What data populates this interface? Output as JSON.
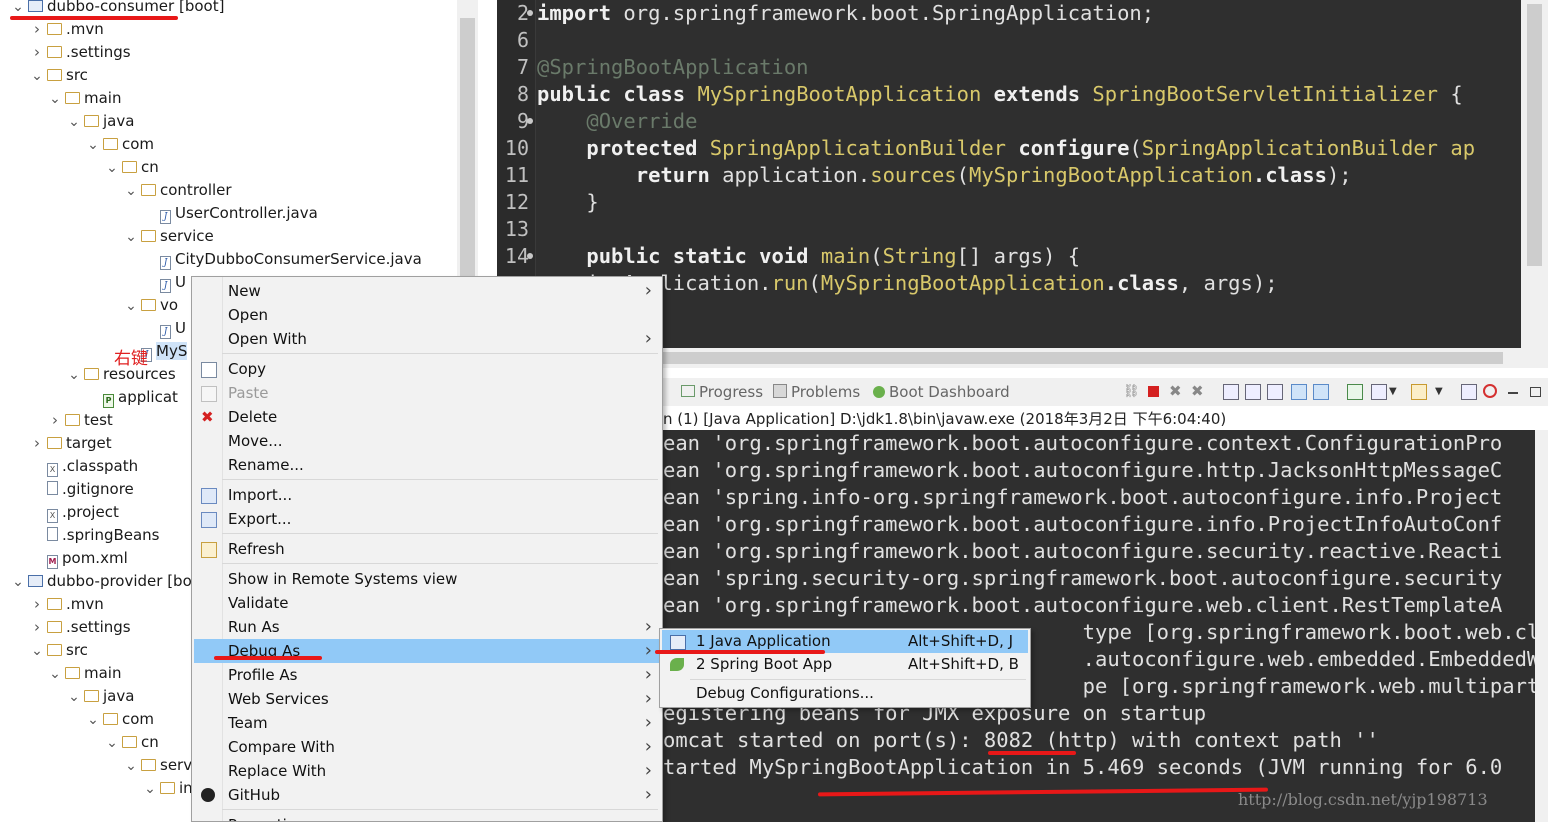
{
  "explorer": {
    "items": [
      {
        "label": "dubbo-consumer [boot]",
        "depth": 0,
        "expanded": true,
        "icon": "project"
      },
      {
        "label": ".mvn",
        "depth": 1,
        "expanded": false,
        "icon": "folder"
      },
      {
        "label": ".settings",
        "depth": 1,
        "expanded": false,
        "icon": "folder"
      },
      {
        "label": "src",
        "depth": 1,
        "expanded": true,
        "icon": "folder"
      },
      {
        "label": "main",
        "depth": 2,
        "expanded": true,
        "icon": "folder"
      },
      {
        "label": "java",
        "depth": 3,
        "expanded": true,
        "icon": "folder"
      },
      {
        "label": "com",
        "depth": 4,
        "expanded": true,
        "icon": "folder"
      },
      {
        "label": "cn",
        "depth": 5,
        "expanded": true,
        "icon": "folder"
      },
      {
        "label": "controller",
        "depth": 6,
        "expanded": true,
        "icon": "folder"
      },
      {
        "label": "UserController.java",
        "depth": 7,
        "icon": "java"
      },
      {
        "label": "service",
        "depth": 6,
        "expanded": true,
        "icon": "folder"
      },
      {
        "label": "CityDubboConsumerService.java",
        "depth": 7,
        "icon": "java"
      },
      {
        "label": "U",
        "depth": 7,
        "icon": "java"
      },
      {
        "label": "vo",
        "depth": 6,
        "expanded": true,
        "icon": "folder"
      },
      {
        "label": "U",
        "depth": 7,
        "icon": "java"
      },
      {
        "label": "MyS",
        "depth": 6,
        "icon": "java",
        "selected": true
      },
      {
        "label": "resources",
        "depth": 3,
        "expanded": true,
        "icon": "folder"
      },
      {
        "label": "applicat",
        "depth": 4,
        "icon": "properties"
      },
      {
        "label": "test",
        "depth": 2,
        "expanded": false,
        "icon": "folder"
      },
      {
        "label": "target",
        "depth": 1,
        "expanded": false,
        "icon": "folder"
      },
      {
        "label": ".classpath",
        "depth": 1,
        "icon": "xml"
      },
      {
        "label": ".gitignore",
        "depth": 1,
        "icon": "file"
      },
      {
        "label": ".project",
        "depth": 1,
        "icon": "xml"
      },
      {
        "label": ".springBeans",
        "depth": 1,
        "icon": "file"
      },
      {
        "label": "pom.xml",
        "depth": 1,
        "icon": "maven"
      },
      {
        "label": "dubbo-provider [bo",
        "depth": 0,
        "expanded": true,
        "icon": "project"
      },
      {
        "label": ".mvn",
        "depth": 1,
        "expanded": false,
        "icon": "folder"
      },
      {
        "label": ".settings",
        "depth": 1,
        "expanded": false,
        "icon": "folder"
      },
      {
        "label": "src",
        "depth": 1,
        "expanded": true,
        "icon": "folder"
      },
      {
        "label": "main",
        "depth": 2,
        "expanded": true,
        "icon": "folder"
      },
      {
        "label": "java",
        "depth": 3,
        "expanded": true,
        "icon": "folder"
      },
      {
        "label": "com",
        "depth": 4,
        "expanded": true,
        "icon": "folder"
      },
      {
        "label": "cn",
        "depth": 5,
        "expanded": true,
        "icon": "folder"
      },
      {
        "label": "serv",
        "depth": 6,
        "expanded": true,
        "icon": "folder"
      },
      {
        "label": "in",
        "depth": 7,
        "expanded": true,
        "icon": "folder"
      }
    ],
    "annotation": "右键"
  },
  "editor": {
    "lines": [
      {
        "num": "2",
        "marker": "fold",
        "parts": [
          {
            "t": "import ",
            "c": "kw"
          },
          {
            "t": "org.springframework.boot.SpringApplication;",
            "c": "pl"
          }
        ]
      },
      {
        "num": "6",
        "parts": []
      },
      {
        "num": "7",
        "parts": [
          {
            "t": "@SpringBootApplication",
            "c": "an"
          }
        ]
      },
      {
        "num": "8",
        "parts": [
          {
            "t": "public class ",
            "c": "kw"
          },
          {
            "t": "MySpringBootApplication ",
            "c": "ty"
          },
          {
            "t": "extends ",
            "c": "kw"
          },
          {
            "t": "SpringBootServletInitializer ",
            "c": "ty"
          },
          {
            "t": "{",
            "c": "pl"
          }
        ]
      },
      {
        "num": "9",
        "marker": "fold",
        "parts": [
          {
            "t": "    @Override",
            "c": "an"
          }
        ]
      },
      {
        "num": "10",
        "marker": "override",
        "parts": [
          {
            "t": "    protected ",
            "c": "kw"
          },
          {
            "t": "SpringApplicationBuilder ",
            "c": "ty"
          },
          {
            "t": "configure",
            "c": "cl"
          },
          {
            "t": "(",
            "c": "pl"
          },
          {
            "t": "SpringApplicationBuilder ap",
            "c": "ty"
          }
        ]
      },
      {
        "num": "11",
        "parts": [
          {
            "t": "        return ",
            "c": "kw"
          },
          {
            "t": "application.",
            "c": "pl"
          },
          {
            "t": "sources",
            "c": "ty"
          },
          {
            "t": "(",
            "c": "pl"
          },
          {
            "t": "MySpringBootApplication",
            "c": "ty"
          },
          {
            "t": ".class",
            "c": "kw"
          },
          {
            "t": ");",
            "c": "pl"
          }
        ]
      },
      {
        "num": "12",
        "parts": [
          {
            "t": "    }",
            "c": "pl"
          }
        ]
      },
      {
        "num": "13",
        "parts": []
      },
      {
        "num": "14",
        "marker": "fold",
        "parts": [
          {
            "t": "    public static void ",
            "c": "kw"
          },
          {
            "t": "main",
            "c": "ty"
          },
          {
            "t": "(",
            "c": "pl"
          },
          {
            "t": "String",
            "c": "ty"
          },
          {
            "t": "[] args) {",
            "c": "pl"
          }
        ]
      },
      {
        "num": "",
        "parts": [
          {
            "t": "  pringApplication.",
            "c": "pl"
          },
          {
            "t": "run",
            "c": "ty"
          },
          {
            "t": "(",
            "c": "pl"
          },
          {
            "t": "MySpringBootApplication",
            "c": "ty"
          },
          {
            "t": ".class",
            "c": "kw"
          },
          {
            "t": ", args);",
            "c": "pl"
          }
        ]
      }
    ]
  },
  "console": {
    "tabs": [
      "Progress",
      "Problems",
      "Boot Dashboard"
    ],
    "description": "n (1) [Java Application] D:\\jdk1.8\\bin\\javaw.exe (2018年3月2日 下午6:04:40)",
    "lines": [
      "ean 'org.springframework.boot.autoconfigure.context.ConfigurationPro",
      "ean 'org.springframework.boot.autoconfigure.http.JacksonHttpMessageC",
      "ean 'spring.info-org.springframework.boot.autoconfigure.info.Project",
      "ean 'org.springframework.boot.autoconfigure.info.ProjectInfoAutoConf",
      "ean 'org.springframework.boot.autoconfigure.security.reactive.Reacti",
      "ean 'spring.security-org.springframework.boot.autoconfigure.security",
      "ean 'org.springframework.boot.autoconfigure.web.client.RestTemplateA",
      "                                  type [org.springframework.boot.web.clie",
      "                                  .autoconfigure.web.embedded.EmbeddedWeb",
      "                                  pe [org.springframework.web.multipart.s",
      "egistering beans for JMX exposure on startup",
      "omcat started on port(s): 8082 (http) with context path ''",
      "tarted MySpringBootApplication in 5.469 seconds (JVM running for 6.0"
    ],
    "watermark": "http://blog.csdn.net/yjp198713"
  },
  "context_menu": {
    "items": [
      {
        "type": "item",
        "label": "New",
        "arrow": true
      },
      {
        "type": "item",
        "label": "Open"
      },
      {
        "type": "item",
        "label": "Open With",
        "arrow": true
      },
      {
        "type": "sep"
      },
      {
        "type": "item",
        "label": "Copy",
        "icon": "copy"
      },
      {
        "type": "item",
        "label": "Paste",
        "icon": "paste",
        "disabled": true
      },
      {
        "type": "item",
        "label": "Delete",
        "icon": "delete"
      },
      {
        "type": "item",
        "label": "Move..."
      },
      {
        "type": "item",
        "label": "Rename..."
      },
      {
        "type": "sep"
      },
      {
        "type": "item",
        "label": "Import...",
        "icon": "import"
      },
      {
        "type": "item",
        "label": "Export...",
        "icon": "export"
      },
      {
        "type": "sep"
      },
      {
        "type": "item",
        "label": "Refresh",
        "icon": "refresh"
      },
      {
        "type": "sep"
      },
      {
        "type": "item",
        "label": "Show in Remote Systems view"
      },
      {
        "type": "item",
        "label": "Validate"
      },
      {
        "type": "item",
        "label": "Run As",
        "arrow": true
      },
      {
        "type": "item",
        "label": "Debug As",
        "arrow": true,
        "selected": true
      },
      {
        "type": "item",
        "label": "Profile As",
        "arrow": true
      },
      {
        "type": "item",
        "label": "Web Services",
        "arrow": true
      },
      {
        "type": "item",
        "label": "Team",
        "arrow": true
      },
      {
        "type": "item",
        "label": "Compare With",
        "arrow": true
      },
      {
        "type": "item",
        "label": "Replace With",
        "arrow": true
      },
      {
        "type": "item",
        "label": "GitHub",
        "icon": "github",
        "arrow": true
      },
      {
        "type": "sep"
      },
      {
        "type": "item",
        "label": "Properties"
      }
    ]
  },
  "submenu": {
    "items": [
      {
        "label": "1 Java Application",
        "shortcut": "Alt+Shift+D, J",
        "icon": "java-app",
        "selected": true
      },
      {
        "label": "2 Spring Boot App",
        "shortcut": "Alt+Shift+D, B",
        "icon": "spring-boot"
      },
      {
        "label": "Debug Configurations...",
        "shortcut": ""
      }
    ]
  },
  "colors": {
    "highlight": "#91c9f7",
    "annotation_red": "#e81818",
    "editor_bg": "#2f2f2f"
  }
}
